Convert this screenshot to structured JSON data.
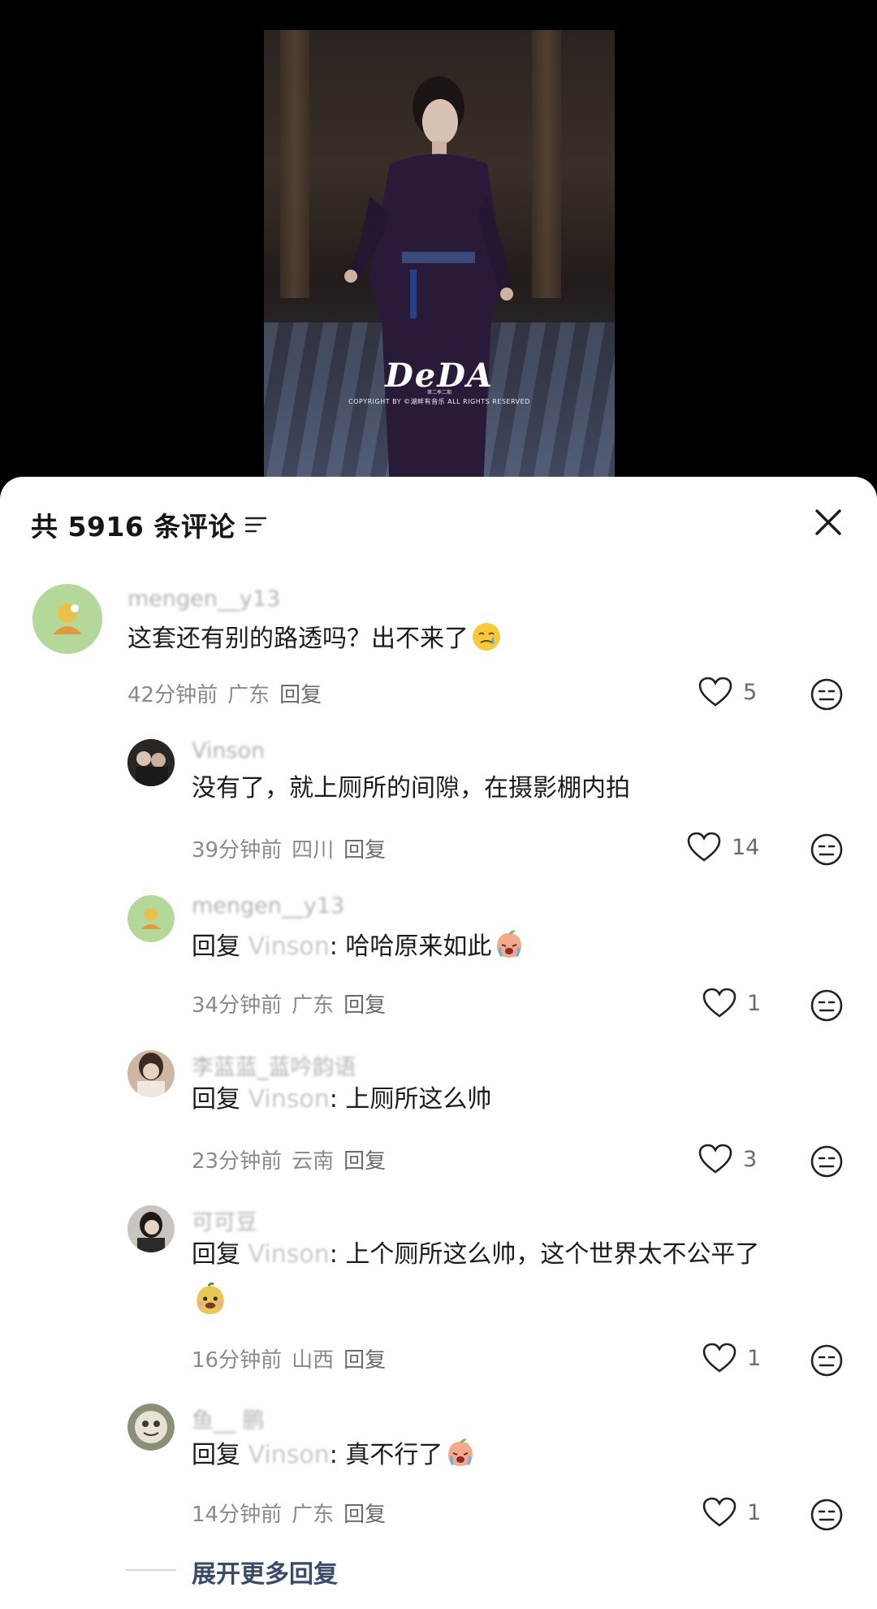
{
  "video": {
    "watermark_logo": "DeDA",
    "watermark_copyright": "COPYRIGHT BY ©湖畔有音乐 ALL RIGHTS RESERVED",
    "watermark_small": "第二季二期"
  },
  "header": {
    "title": "共 5916 条评论",
    "sort_icon": "sort-filter-icon",
    "close_icon": "close-icon"
  },
  "comments": [
    {
      "username": "mengen__y13",
      "text": "这套还有别的路透吗？出不来了",
      "emoji": "crying-smile-emoji",
      "time": "42分钟前",
      "location": "广东",
      "reply_label": "回复",
      "likes": "5",
      "is_reply": false
    },
    {
      "username": "Vinson",
      "text": "没有了，就上厕所的间隙，在摄影棚内拍",
      "time": "39分钟前",
      "location": "四川",
      "reply_label": "回复",
      "likes": "14",
      "is_reply": true
    },
    {
      "username": "mengen__y13",
      "reply_prefix": "回复",
      "reply_target": "Vinson",
      "text": ": 哈哈原来如此",
      "emoji": "crying-peach-emoji",
      "time": "34分钟前",
      "location": "广东",
      "reply_label": "回复",
      "likes": "1",
      "is_reply": true
    },
    {
      "username": "李蓝蓝_蓝吟韵语",
      "reply_prefix": "回复",
      "reply_target": "Vinson",
      "text": ": 上厕所这么帅",
      "time": "23分钟前",
      "location": "云南",
      "reply_label": "回复",
      "likes": "3",
      "is_reply": true
    },
    {
      "username": "可可豆",
      "reply_prefix": "回复",
      "reply_target": "Vinson",
      "text": ": 上个厕所这么帅，这个世界太不公平了",
      "emoji": "smiling-potato-emoji",
      "time": "16分钟前",
      "location": "山西",
      "reply_label": "回复",
      "likes": "1",
      "is_reply": true
    },
    {
      "username": "鱼__ 鹏",
      "reply_prefix": "回复",
      "reply_target": "Vinson",
      "text": ": 真不行了",
      "emoji": "crying-peach-emoji",
      "time": "14分钟前",
      "location": "广东",
      "reply_label": "回复",
      "likes": "1",
      "is_reply": true
    }
  ],
  "expand_more": "展开更多回复",
  "colors": {
    "sheet_bg": "#ffffff",
    "text_primary": "#1c1c1c",
    "text_meta": "#8a8a8a",
    "expand_link": "#3a4a6a"
  }
}
